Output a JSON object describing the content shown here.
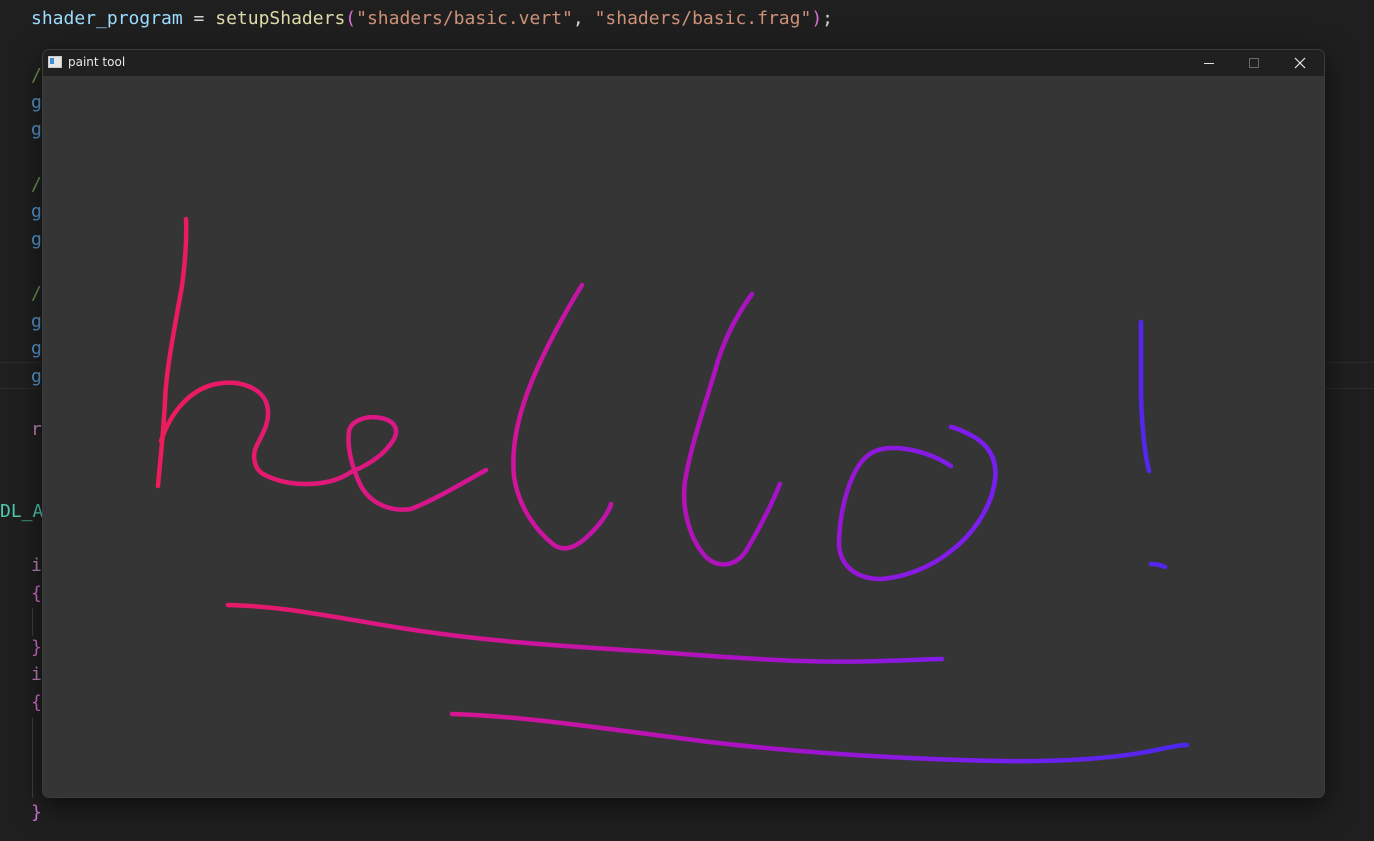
{
  "editor": {
    "line1": {
      "var": "shader_program",
      "op": " = ",
      "fn": "setupShaders",
      "open": "(",
      "arg1": "\"shaders/basic.vert\"",
      "comma": ", ",
      "arg2": "\"shaders/basic.frag\"",
      "close": ")",
      "semi": ";"
    },
    "fragments": {
      "c1": "/",
      "g1": "g",
      "g2": "g",
      "c2": "/",
      "g3": "g",
      "g4": "g",
      "c3": "/",
      "g5": "g",
      "g6": "g",
      "g7": "g",
      "r1": "r",
      "dl": "DL_A",
      "i1": "i",
      "b1": "{",
      "b2": "}",
      "i2": "i",
      "b3": "{",
      "b4": "}"
    }
  },
  "window": {
    "title": "paint tool",
    "icon": "app-window-icon",
    "controls": [
      "minimize-icon",
      "maximize-icon",
      "close-icon"
    ]
  },
  "drawing": {
    "text_written": "hello!",
    "colors": {
      "pink": "#ee1c5a",
      "magenta": "#d0149c",
      "purple": "#a512c8",
      "violet": "#7a1ef0",
      "blue": "#4a28ee"
    }
  }
}
